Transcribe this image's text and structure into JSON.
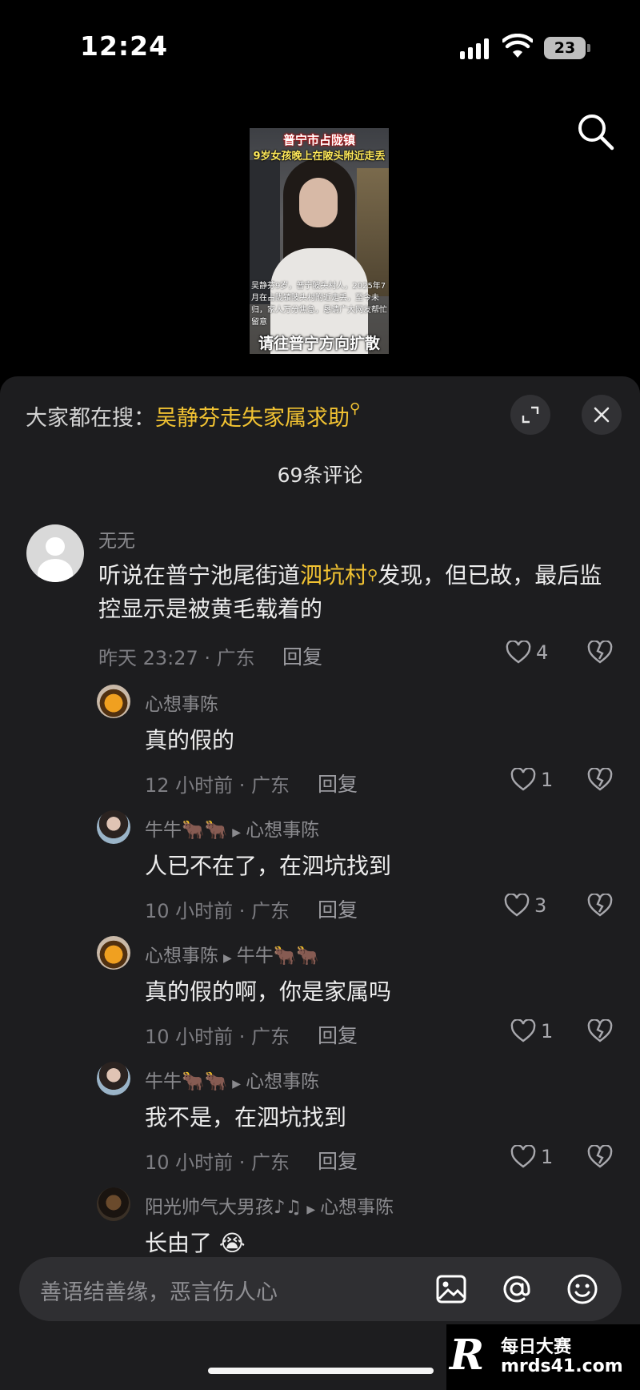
{
  "status_bar": {
    "time": "12:24",
    "battery": "23"
  },
  "video": {
    "title_line1": "普宁市占陇镇",
    "title_line2": "9岁女孩晚上在陂头附近走丢",
    "body_text": "吴静芬9岁，普宁陂头村人，2025年7月在占陇镇陂头村附近走丢，至今未归，家人万分焦急，恳请广大网友帮忙留意",
    "bottom_text": "请往普宁方向扩散"
  },
  "panel": {
    "trend_prefix": "大家都在搜：",
    "trend_keyword": "吴静芬走失家属求助",
    "comment_count": "69条评论"
  },
  "comments": [
    {
      "user": "无无",
      "text_before": "听说在普宁池尾街道",
      "text_link": "泗坑村",
      "text_after": "发现，但已故，最后监控显示是被黄毛载着的",
      "meta": "昨天 23:27 · 广东",
      "reply_label": "回复",
      "likes": "4"
    },
    {
      "user": "心想事陈",
      "text": "真的假的",
      "meta": "12 小时前 · 广东",
      "reply_label": "回复",
      "likes": "1"
    },
    {
      "user": "牛牛🐂🐂",
      "reply_to": "心想事陈",
      "text": "人已不在了，在泗坑找到",
      "meta": "10 小时前 · 广东",
      "reply_label": "回复",
      "likes": "3"
    },
    {
      "user": "心想事陈",
      "reply_to": "牛牛🐂🐂",
      "text": "真的假的啊，你是家属吗",
      "meta": "10 小时前 · 广东",
      "reply_label": "回复",
      "likes": "1"
    },
    {
      "user": "牛牛🐂🐂",
      "reply_to": "心想事陈",
      "text": "我不是，在泗坑找到",
      "meta": "10 小时前 · 广东",
      "reply_label": "回复",
      "likes": "1"
    },
    {
      "user": "阳光帅气大男孩♪♫",
      "reply_to": "心想事陈",
      "text": "长由了 😭"
    }
  ],
  "input": {
    "placeholder": "善语结善缘，恶言伤人心"
  },
  "watermark": {
    "name": "每日大赛",
    "url": "mrds41.com",
    "logo": "R"
  },
  "icons": {
    "search": "search-icon",
    "expand": "expand-icon",
    "close": "close-icon",
    "heart": "heart-icon",
    "broken_heart": "broken-heart-icon",
    "image": "image-icon",
    "at": "at-icon",
    "emoji": "emoji-icon"
  },
  "colors": {
    "accent": "#f1c232",
    "panel": "#1d1d1f",
    "input": "#2f2f32"
  }
}
